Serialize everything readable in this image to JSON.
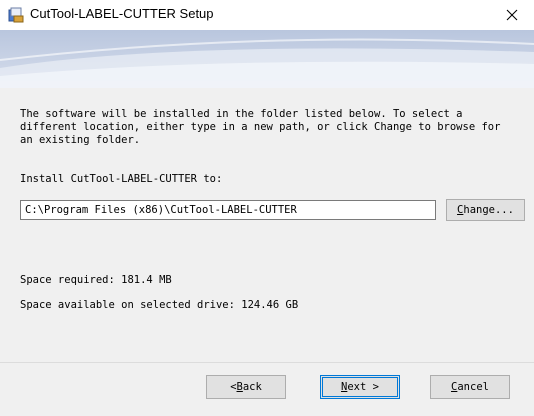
{
  "window": {
    "title": "CutTool-LABEL-CUTTER Setup",
    "close_label": "×"
  },
  "content": {
    "description": "The software will be installed in the folder listed below. To select a\ndifferent location, either type in a new path, or click Change to browse for\nan existing folder.",
    "install_label": "Install CutTool-LABEL-CUTTER to:",
    "install_path": "C:\\Program Files (x86)\\CutTool-LABEL-CUTTER",
    "change_button": {
      "mnemonic": "C",
      "rest": "hange..."
    },
    "space_required": "Space required: 181.4 MB",
    "space_available": "Space available on selected drive: 124.46 GB"
  },
  "footer": {
    "back_button": {
      "prefix": "< ",
      "mnemonic": "B",
      "rest": "ack"
    },
    "next_button": {
      "mnemonic": "N",
      "rest": "ext >"
    },
    "cancel_button": {
      "mnemonic": "C",
      "rest": "ancel"
    }
  },
  "colors": {
    "banner": "#c8d3e6",
    "focus": "#0078d7"
  },
  "icons": {
    "app": "installer-app-icon",
    "close": "close-icon"
  }
}
